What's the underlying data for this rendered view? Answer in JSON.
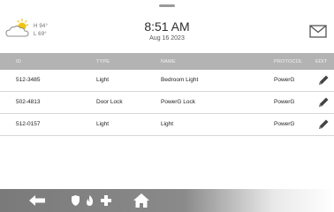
{
  "header": {
    "weather": {
      "high": "H 94°",
      "low": "L 69°",
      "icon": "partly-cloudy-icon"
    },
    "time": "8:51 AM",
    "date": "Aug 16 2023",
    "mail_icon": "envelope-icon"
  },
  "table": {
    "columns": {
      "id": "ID",
      "type": "TYPE",
      "name": "NAME",
      "protocol": "PROTOCOL",
      "edit": "EDIT"
    },
    "rows": [
      {
        "id": "512-3485",
        "type": "Light",
        "name": "Bedroom Light",
        "protocol": "PowerG"
      },
      {
        "id": "502-4813",
        "type": "Door Lock",
        "name": "PowerG Lock",
        "protocol": "PowerG"
      },
      {
        "id": "512-0157",
        "type": "Light",
        "name": "Light",
        "protocol": "PowerG"
      }
    ]
  },
  "navbar": {
    "icons": [
      "back-arrow-icon",
      "shield-icon",
      "fire-icon",
      "medical-cross-icon",
      "home-icon"
    ]
  },
  "colors": {
    "table_header_bg": "#b3b3b3",
    "navbar_bg": "#7a7a7a",
    "weather_sun": "#f2c40f"
  }
}
